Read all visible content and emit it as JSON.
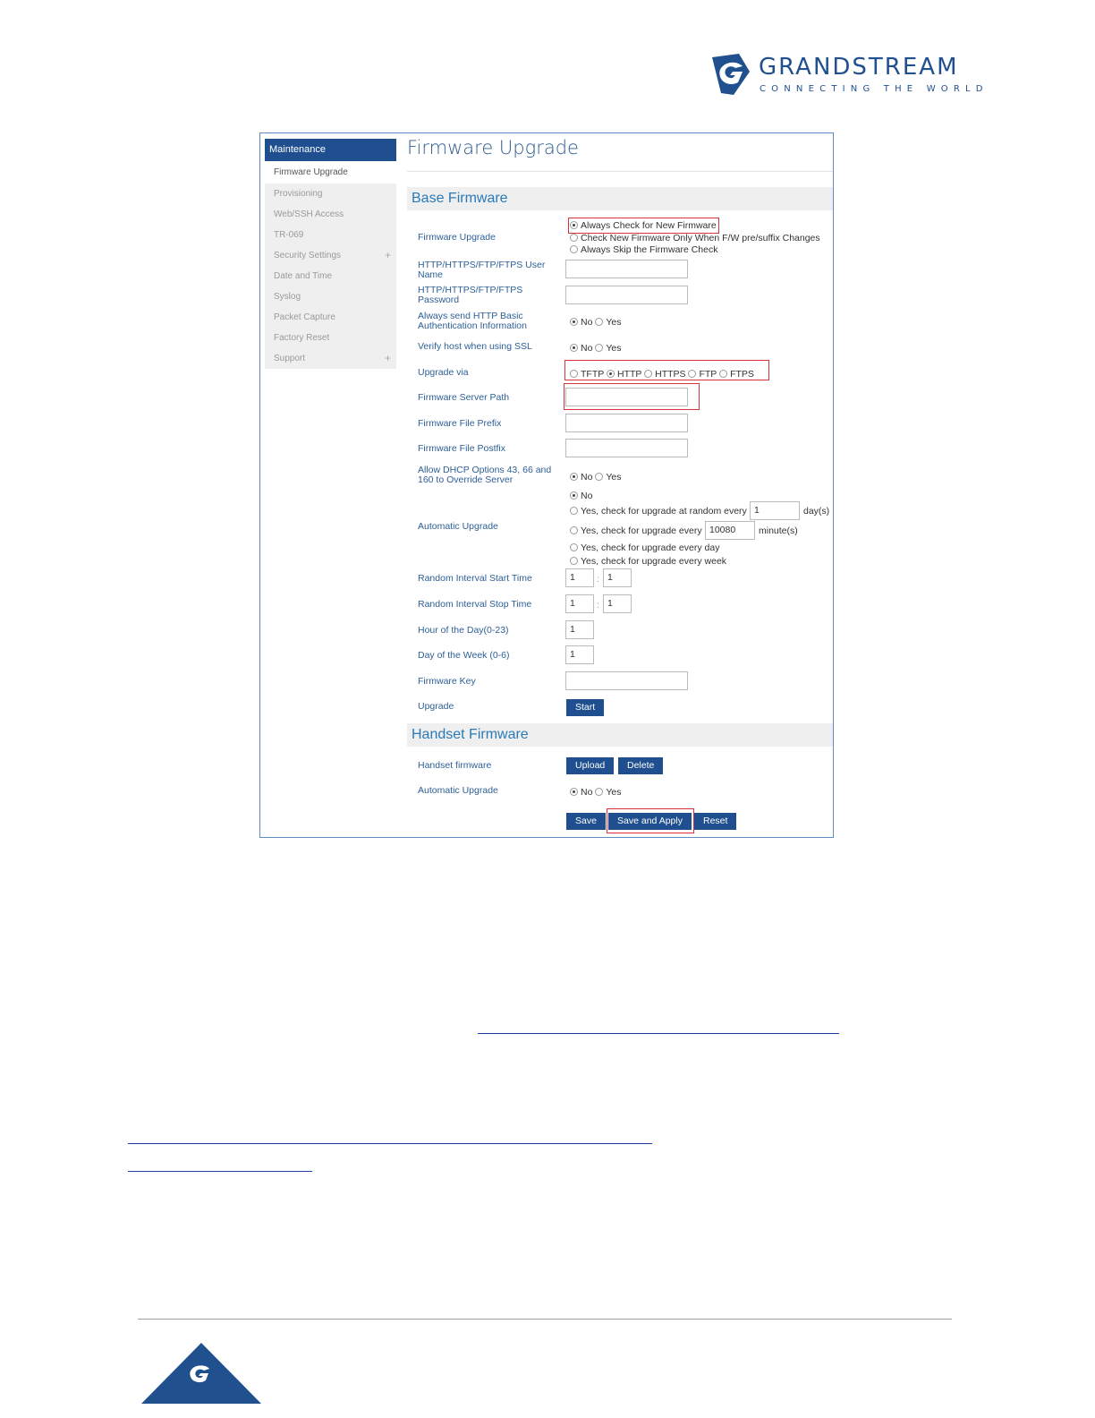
{
  "logo": {
    "word": "GRANDSTREAM",
    "tagline": "CONNECTING THE WORLD",
    "color": "#21508f"
  },
  "sidebar": {
    "header": "Maintenance",
    "items": [
      {
        "label": "Firmware Upgrade"
      },
      {
        "label": "Provisioning"
      },
      {
        "label": "Web/SSH Access"
      },
      {
        "label": "TR-069"
      },
      {
        "label": "Security Settings",
        "expand": "+"
      },
      {
        "label": "Date and Time"
      },
      {
        "label": "Syslog"
      },
      {
        "label": "Packet Capture"
      },
      {
        "label": "Factory Reset"
      },
      {
        "label": "Support",
        "expand": "+"
      }
    ]
  },
  "page": {
    "title": "Firmware Upgrade",
    "base_section": "Base Firmware",
    "handset_section": "Handset Firmware"
  },
  "fields": {
    "firmware_upgrade": {
      "label": "Firmware Upgrade",
      "options": [
        "Always Check for New Firmware",
        "Check New Firmware Only When F/W pre/suffix Changes",
        "Always Skip the Firmware Check"
      ]
    },
    "user_name": {
      "label": "HTTP/HTTPS/FTP/FTPS User Name"
    },
    "password": {
      "label": "HTTP/HTTPS/FTP/FTPS Password"
    },
    "basic_auth": {
      "label": "Always send HTTP Basic Authentication Information",
      "no": "No",
      "yes": "Yes"
    },
    "verify_ssl": {
      "label": "Verify host when using SSL",
      "no": "No",
      "yes": "Yes"
    },
    "upgrade_via": {
      "label": "Upgrade via",
      "options": [
        "TFTP",
        "HTTP",
        "HTTPS",
        "FTP",
        "FTPS"
      ]
    },
    "server_path": {
      "label": "Firmware Server Path"
    },
    "file_prefix": {
      "label": "Firmware File Prefix"
    },
    "file_postfix": {
      "label": "Firmware File Postfix"
    },
    "dhcp_override": {
      "label": "Allow DHCP Options 43, 66 and 160 to Override Server",
      "no": "No",
      "yes": "Yes"
    },
    "auto_upgrade": {
      "label": "Automatic Upgrade",
      "no": "No",
      "random_label": "Yes, check for upgrade at random every",
      "random_value": "1",
      "random_unit": "day(s)",
      "every_label": "Yes, check for upgrade every",
      "every_value": "10080",
      "every_unit": "minute(s)",
      "daily": "Yes, check for upgrade every day",
      "weekly": "Yes, check for upgrade every week"
    },
    "random_start": {
      "label": "Random Interval Start Time",
      "h": "1",
      "m": "1"
    },
    "random_stop": {
      "label": "Random Interval Stop Time",
      "h": "1",
      "m": "1"
    },
    "hour_of_day": {
      "label": "Hour of the Day(0-23)",
      "value": "1"
    },
    "day_of_week": {
      "label": "Day of the Week (0-6)",
      "value": "1"
    },
    "firmware_key": {
      "label": "Firmware Key"
    },
    "upgrade": {
      "label": "Upgrade",
      "button": "Start"
    },
    "handset_firmware": {
      "label": "Handset firmware",
      "upload": "Upload",
      "delete": "Delete"
    },
    "handset_auto": {
      "label": "Automatic Upgrade",
      "no": "No",
      "yes": "Yes"
    }
  },
  "actions": {
    "save": "Save",
    "save_apply": "Save and Apply",
    "reset": "Reset"
  },
  "colors": {
    "accent": "#1f4f8f",
    "highlight": "#d9343c",
    "label": "#2c5f96"
  }
}
